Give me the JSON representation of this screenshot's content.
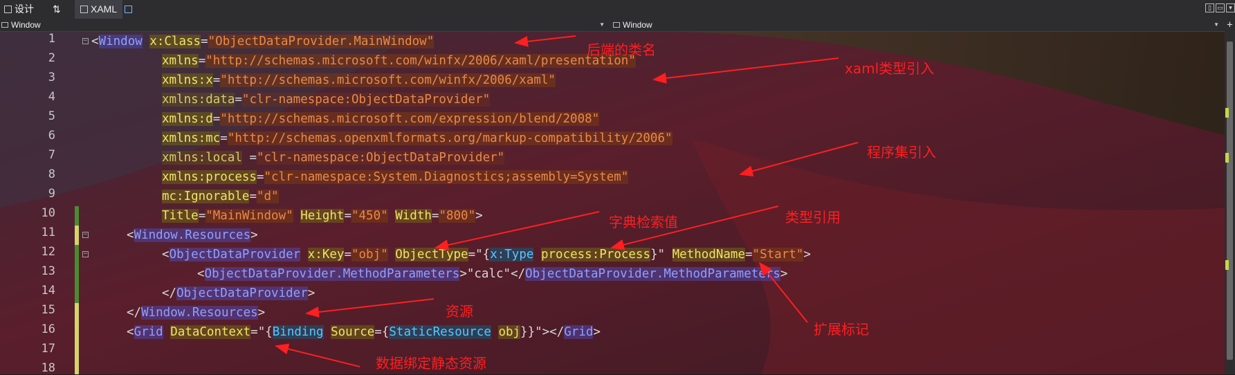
{
  "tabs": [
    {
      "label": "设计",
      "icon": "design-icon"
    },
    {
      "label": "⇅",
      "icon": "swap-icon"
    },
    {
      "label": "XAML",
      "icon": "xaml-icon"
    }
  ],
  "nav": {
    "left_combo": "Window",
    "right_combo": "Window"
  },
  "line_numbers": [
    "1",
    "2",
    "3",
    "4",
    "5",
    "6",
    "7",
    "8",
    "9",
    "10",
    "11",
    "12",
    "13",
    "14",
    "15",
    "16",
    "17",
    "18"
  ],
  "code": {
    "l1": {
      "lt": "<",
      "el": "Window",
      "attr": "x:Class",
      "eq": "=",
      "val": "\"ObjectDataProvider.MainWindow\""
    },
    "l2": {
      "attr": "xmlns",
      "eq": "=",
      "val": "\"http://schemas.microsoft.com/winfx/2006/xaml/presentation\""
    },
    "l3": {
      "attr": "xmlns:x",
      "eq": "=",
      "val": "\"http://schemas.microsoft.com/winfx/2006/xaml\""
    },
    "l4": {
      "attr": "xmlns:data",
      "eq": "=",
      "val": "\"clr-namespace:ObjectDataProvider\""
    },
    "l5": {
      "attr": "xmlns:d",
      "eq": "=",
      "val": "\"http://schemas.microsoft.com/expression/blend/2008\""
    },
    "l6": {
      "attr": "xmlns:mc",
      "eq": "=",
      "val": "\"http://schemas.openxmlformats.org/markup-compatibility/2006\""
    },
    "l7": {
      "attr": "xmlns:local",
      "eq": " =",
      "val": "\"clr-namespace:ObjectDataProvider\""
    },
    "l8": {
      "attr": "xmlns:process",
      "eq": "=",
      "val": "\"clr-namespace:System.Diagnostics;assembly=System\""
    },
    "l9": {
      "attr": "mc:Ignorable",
      "eq": "=",
      "val": "\"d\""
    },
    "l10": {
      "a1": "Title",
      "v1": "\"MainWindow\"",
      "a2": "Height",
      "v2": "\"450\"",
      "a3": "Width",
      "v3": "\"800\"",
      "gt": ">"
    },
    "l11": {
      "lt": "<",
      "el": "Window.Resources",
      "gt": ">"
    },
    "l12": {
      "lt": "<",
      "el": "ObjectDataProvider",
      "a1": "x:Key",
      "v1": "\"obj\"",
      "a2": "ObjectType",
      "q1": "\"{",
      "me": "x:Type",
      "a3": "process:Process",
      "q2": "}\"",
      "a4": "MethodName",
      "v4": "\"Start\"",
      "gt": ">"
    },
    "l13": {
      "lt": "<",
      "el": "ObjectDataProvider.MethodParameters",
      "mid": ">\"calc\"</",
      "el2": "ObjectDataProvider.MethodParameters",
      "gt": ">"
    },
    "l14": {
      "lt": "</",
      "el": "ObjectDataProvider",
      "gt": ">"
    },
    "l15": {
      "lt": "</",
      "el": "Window.Resources",
      "gt": ">"
    },
    "l16": {
      "lt": "<",
      "el": "Grid",
      "a1": "DataContext",
      "q1": "=\"{",
      "me1": "Binding",
      "a2": "Source",
      "q2": "={",
      "me2": "StaticResource",
      "a3": "obj",
      "q3": "}}\"",
      "mid": "></",
      "el2": "Grid",
      "gt": ">"
    }
  },
  "annotations": {
    "backend_class": "后端的类名",
    "xaml_import": "xaml类型引入",
    "assembly_import": "程序集引入",
    "dict_key": "字典检索值",
    "type_ref": "类型引用",
    "resources": "资源",
    "markup_ext": "扩展标记",
    "binding_static": "数据绑定静态资源"
  },
  "colors": {
    "annotation": "#ff1f1f",
    "background": "#1e1e1e"
  }
}
